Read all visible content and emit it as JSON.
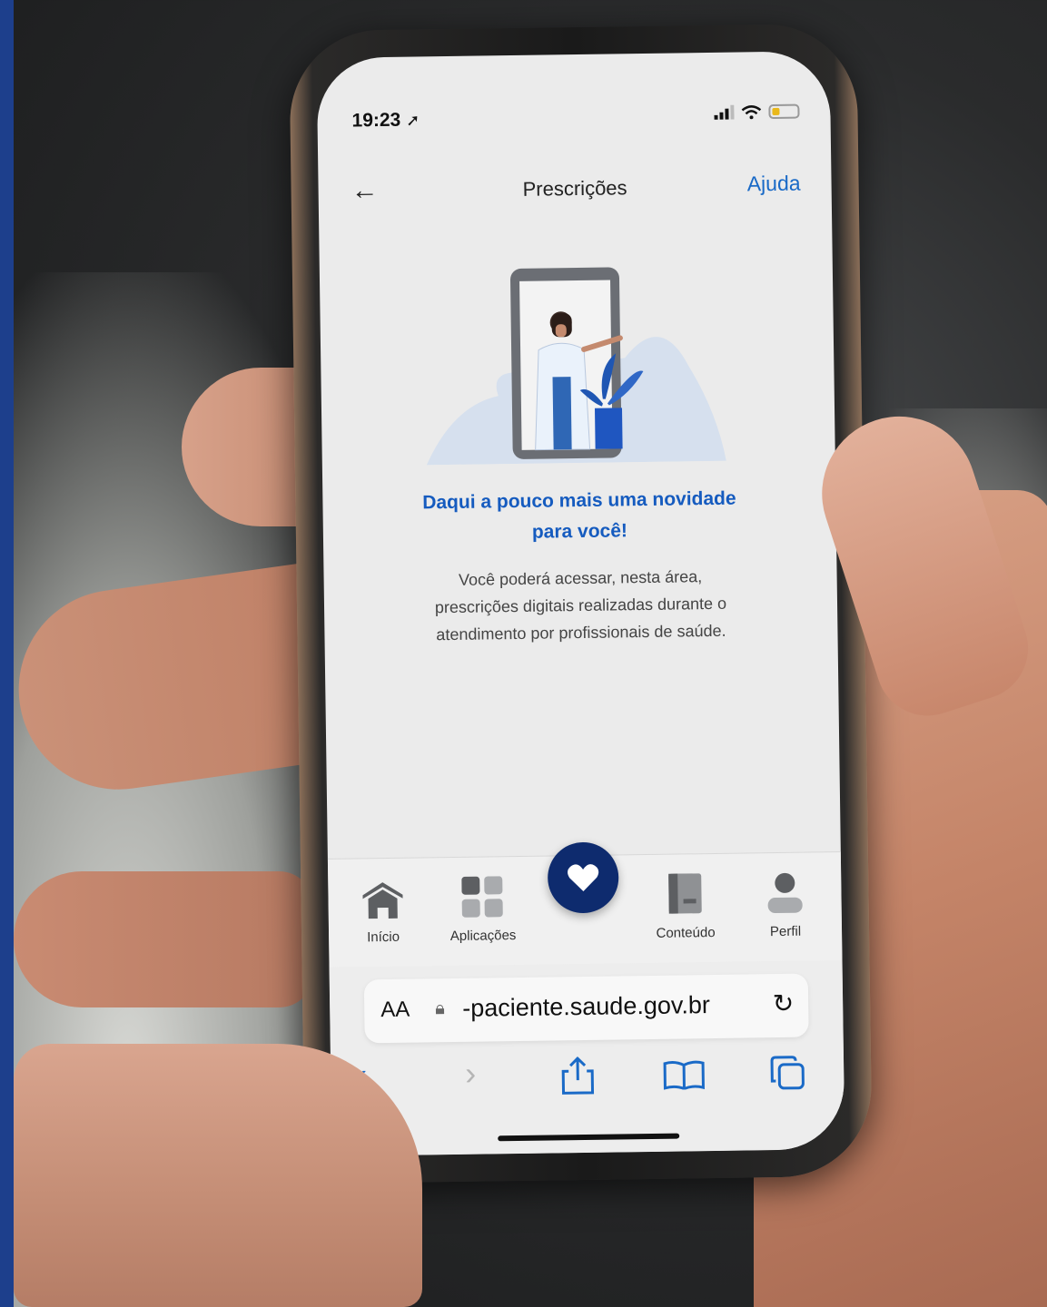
{
  "status_bar": {
    "time": "19:23",
    "location_icon": "location-arrow-icon"
  },
  "header": {
    "title": "Prescrições",
    "help_label": "Ajuda",
    "back_icon": "back-arrow-icon"
  },
  "empty_state": {
    "headline_line1": "Daqui a pouco mais uma novidade",
    "headline_line2": "para você!",
    "body_line1": "Você poderá acessar, nesta área,",
    "body_line2": "prescrições digitais realizadas durante o",
    "body_line3": "atendimento por profissionais de saúde.",
    "illustration": "doctor-in-phone-illustration"
  },
  "tabbar": {
    "items": [
      {
        "label": "Início",
        "icon": "home-icon"
      },
      {
        "label": "Aplicações",
        "icon": "apps-grid-icon"
      },
      {
        "label": "Conteúdo",
        "icon": "book-icon"
      },
      {
        "label": "Perfil",
        "icon": "user-icon"
      }
    ],
    "center_icon": "heart-icon"
  },
  "browser": {
    "text_size_label": "AA",
    "url": "-paciente.saude.gov.br"
  },
  "colors": {
    "accent_blue": "#1a6ac7",
    "fab_navy": "#0e2b6e",
    "headline_blue": "#155bbf",
    "left_stripe": "#1d3f8c"
  }
}
